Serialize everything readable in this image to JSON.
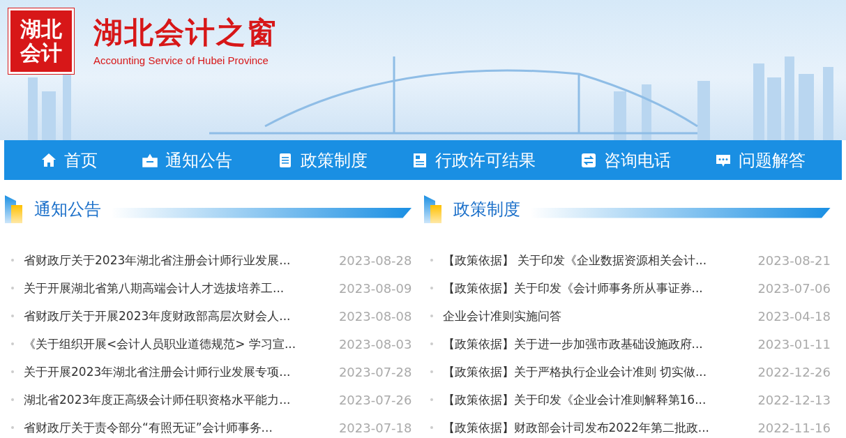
{
  "header": {
    "seal": [
      "湖北",
      "会计"
    ],
    "title": "湖北会计之窗",
    "subtitle": "Accounting Service of Hubei Province"
  },
  "nav": [
    {
      "label": "首页"
    },
    {
      "label": "通知公告"
    },
    {
      "label": "政策制度"
    },
    {
      "label": "行政许可结果"
    },
    {
      "label": "咨询电话"
    },
    {
      "label": "问题解答"
    }
  ],
  "sections": [
    {
      "title": "通知公告",
      "items": [
        {
          "text": "省财政厅关于2023年湖北省注册会计师行业发展...",
          "date": "2023-08-28"
        },
        {
          "text": "关于开展湖北省第八期高端会计人才选拔培养工...",
          "date": "2023-08-09"
        },
        {
          "text": "省财政厅关于开展2023年度财政部高层次财会人...",
          "date": "2023-08-08"
        },
        {
          "text": "《关于组织开展<会计人员职业道德规范> 学习宣...",
          "date": "2023-08-03"
        },
        {
          "text": "关于开展2023年湖北省注册会计师行业发展专项...",
          "date": "2023-07-28"
        },
        {
          "text": "湖北省2023年度正高级会计师任职资格水平能力...",
          "date": "2023-07-26"
        },
        {
          "text": "省财政厅关于责令部分“有照无证”会计师事务...",
          "date": "2023-07-18"
        }
      ]
    },
    {
      "title": "政策制度",
      "items": [
        {
          "text": "【政策依据】 关于印发《企业数据资源相关会计...",
          "date": "2023-08-21"
        },
        {
          "text": "【政策依据】关于印发《会计师事务所从事证券...",
          "date": "2023-07-06"
        },
        {
          "text": "企业会计准则实施问答",
          "date": "2023-04-18"
        },
        {
          "text": "【政策依据】关于进一步加强市政基础设施政府...",
          "date": "2023-01-11"
        },
        {
          "text": "【政策依据】关于严格执行企业会计准则 切实做...",
          "date": "2022-12-26"
        },
        {
          "text": "【政策依据】关于印发《企业会计准则解释第16...",
          "date": "2022-12-13"
        },
        {
          "text": "【政策依据】财政部会计司发布2022年第二批政...",
          "date": "2022-11-16"
        }
      ]
    }
  ]
}
